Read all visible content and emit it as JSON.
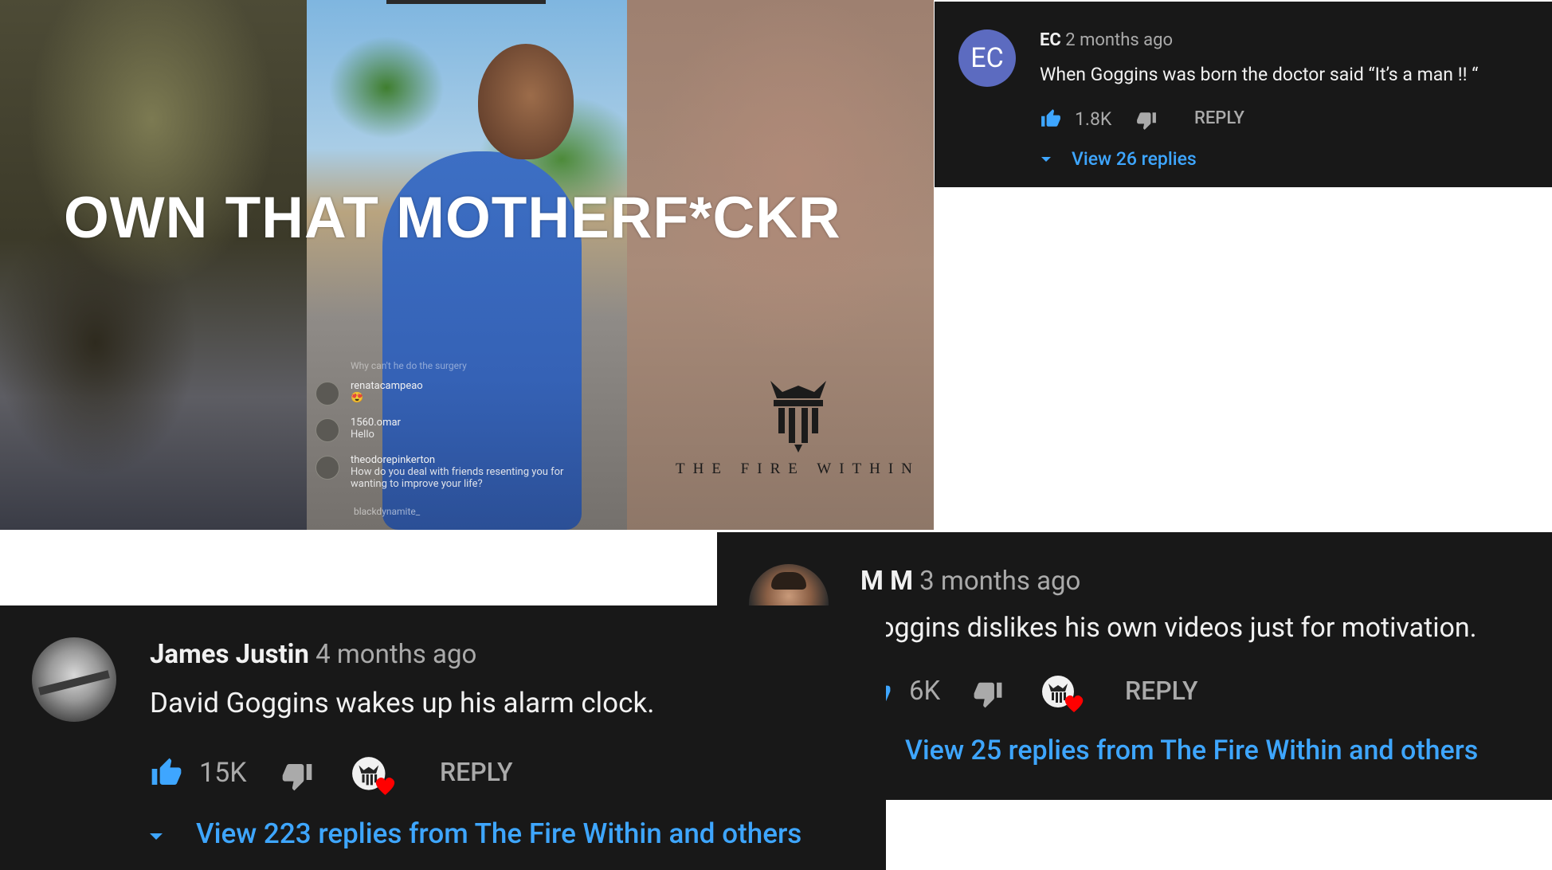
{
  "video": {
    "overlay_title": "OWN THAT MOTHERF*CKR",
    "chat": [
      {
        "user": "Why can't he do the surgery",
        "message": ""
      },
      {
        "user": "renatacampeao",
        "message": "😍"
      },
      {
        "user": "1560.omar",
        "message": "Hello"
      },
      {
        "user": "theodorepinkerton",
        "message": "How do you deal with friends resenting you for wanting to improve your life?"
      },
      {
        "user": "blackdynamite_",
        "message": ""
      }
    ],
    "brand": "THE FIRE WITHIN"
  },
  "comments": [
    {
      "initials": "EC",
      "author": "EC",
      "time": "2 months ago",
      "text": "When Goggins was born the doctor said “It’s a man !! “",
      "likes": "1.8K",
      "reply_label": "REPLY",
      "view_replies": "View 26 replies",
      "avatar_color": "#5c6bc0"
    },
    {
      "author": "James Justin",
      "time": "4 months ago",
      "text": "David Goggins wakes up his alarm clock.",
      "likes": "15K",
      "reply_label": "REPLY",
      "view_replies": "View 223 replies from The Fire Within and others"
    },
    {
      "author": "M M",
      "time": "3 months ago",
      "text": "Goggins dislikes his own videos just for motivation.",
      "likes": "6K",
      "reply_label": "REPLY",
      "view_replies": "View 25 replies from The Fire Within and others"
    }
  ],
  "colors": {
    "card_bg": "#181818",
    "link_blue": "#3ea6ff",
    "heart_red": "#ff0000",
    "muted": "#aaaaaa"
  },
  "icons": [
    "thumbs-up-icon",
    "thumbs-down-icon",
    "creator-heart-icon",
    "caret-down-icon"
  ]
}
